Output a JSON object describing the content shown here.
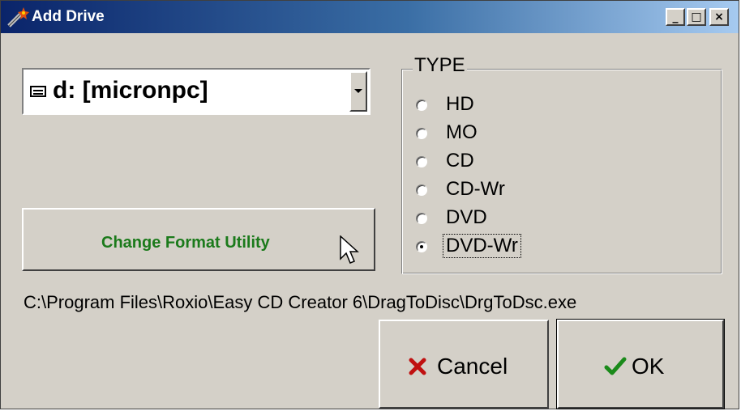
{
  "window": {
    "title": "Add Drive",
    "title_icon": "wand-icon",
    "controls": [
      "_",
      "□",
      "×"
    ]
  },
  "drive_select": {
    "icon": "drive-icon",
    "selected": "d: [micronpc]"
  },
  "format_button": {
    "label": "Change Format Utility",
    "color": "#1b7a1b"
  },
  "type_group": {
    "legend": "TYPE",
    "options": [
      "HD",
      "MO",
      "CD",
      "CD-Wr",
      "DVD",
      "DVD-Wr"
    ],
    "selected": "DVD-Wr"
  },
  "path": "C:\\Program Files\\Roxio\\Easy CD Creator 6\\DragToDisc\\DrgToDsc.exe",
  "buttons": {
    "cancel": {
      "label": "Cancel",
      "icon": "cross-icon",
      "icon_color": "#c01010"
    },
    "ok": {
      "label": "OK",
      "icon": "checkmark-icon",
      "icon_color": "#1a8a1a"
    }
  },
  "colors": {
    "face": "#d4d0c8",
    "titlebar_start": "#0a246a",
    "titlebar_end": "#a6caf0"
  }
}
